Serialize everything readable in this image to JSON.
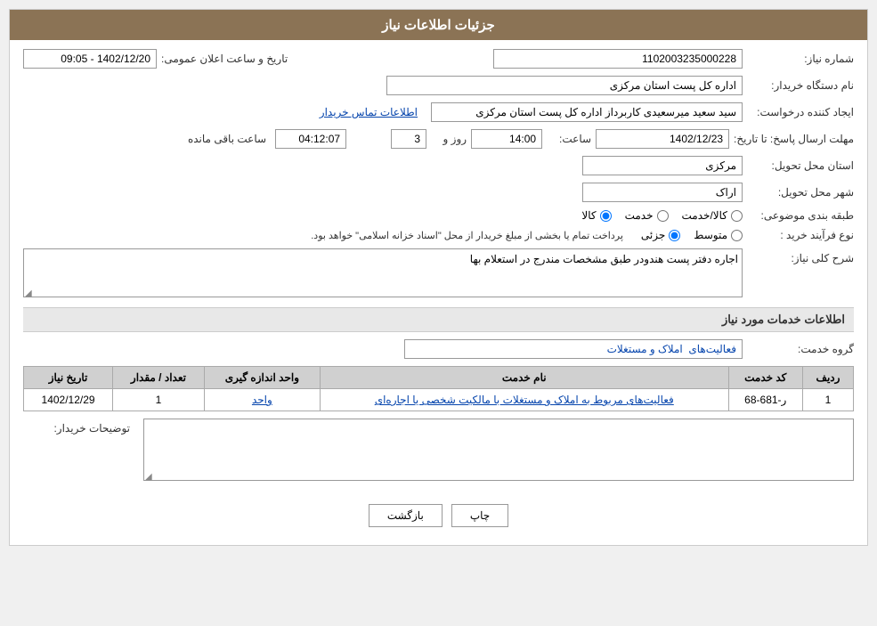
{
  "header": {
    "title": "جزئیات اطلاعات نیاز"
  },
  "fields": {
    "need_number_label": "شماره نیاز:",
    "need_number_value": "1102003235000228",
    "buyer_org_label": "نام دستگاه خریدار:",
    "buyer_org_value": "اداره کل پست استان مرکزی",
    "date_label": "تاریخ و ساعت اعلان عمومی:",
    "date_value": "1402/12/20 - 09:05",
    "creator_label": "ایجاد کننده درخواست:",
    "creator_value": "سید سعید میرسعیدی کاربرداز اداره کل پست استان مرکزی",
    "contact_link": "اطلاعات تماس خریدار",
    "deadline_label": "مهلت ارسال پاسخ: تا تاریخ:",
    "deadline_date": "1402/12/23",
    "deadline_time_label": "ساعت:",
    "deadline_time": "14:00",
    "deadline_days_label": "روز و",
    "deadline_days": "3",
    "deadline_remaining_label": "ساعت باقی مانده",
    "deadline_remaining": "04:12:07",
    "province_label": "استان محل تحویل:",
    "province_value": "مرکزی",
    "city_label": "شهر محل تحویل:",
    "city_value": "اراک",
    "category_label": "طبقه بندی موضوعی:",
    "category_goods": "کالا",
    "category_service": "خدمت",
    "category_goods_service": "کالا/خدمت",
    "purchase_type_label": "نوع فرآیند خرید :",
    "purchase_partial": "جزئی",
    "purchase_medium": "متوسط",
    "purchase_notice": "پرداخت تمام یا بخشی از مبلغ خریدار از محل \"اسناد خزانه اسلامی\" خواهد بود.",
    "need_desc_label": "شرح کلی نیاز:",
    "need_desc_value": "اجاره دفتر پست هندودر طبق مشخصات مندرج در استعلام بها",
    "services_section_title": "اطلاعات خدمات مورد نیاز",
    "service_group_label": "گروه خدمت:",
    "service_group_value": "فعالیت‌های  املاک و مستغلات",
    "table": {
      "col_row": "ردیف",
      "col_code": "کد خدمت",
      "col_name": "نام خدمت",
      "col_unit": "واحد اندازه گیری",
      "col_quantity": "تعداد / مقدار",
      "col_date": "تاریخ نیاز",
      "rows": [
        {
          "row": "1",
          "code": "ر-681-68",
          "name": "فعالیت‌های مربوط به املاک و مستغلات با مالکیت شخصی یا اجاره‌ای",
          "unit": "واحد",
          "quantity": "1",
          "date": "1402/12/29"
        }
      ]
    },
    "buyer_notes_label": "توضیحات خریدار:",
    "buyer_notes_value": ""
  },
  "buttons": {
    "print": "چاپ",
    "back": "بازگشت"
  }
}
